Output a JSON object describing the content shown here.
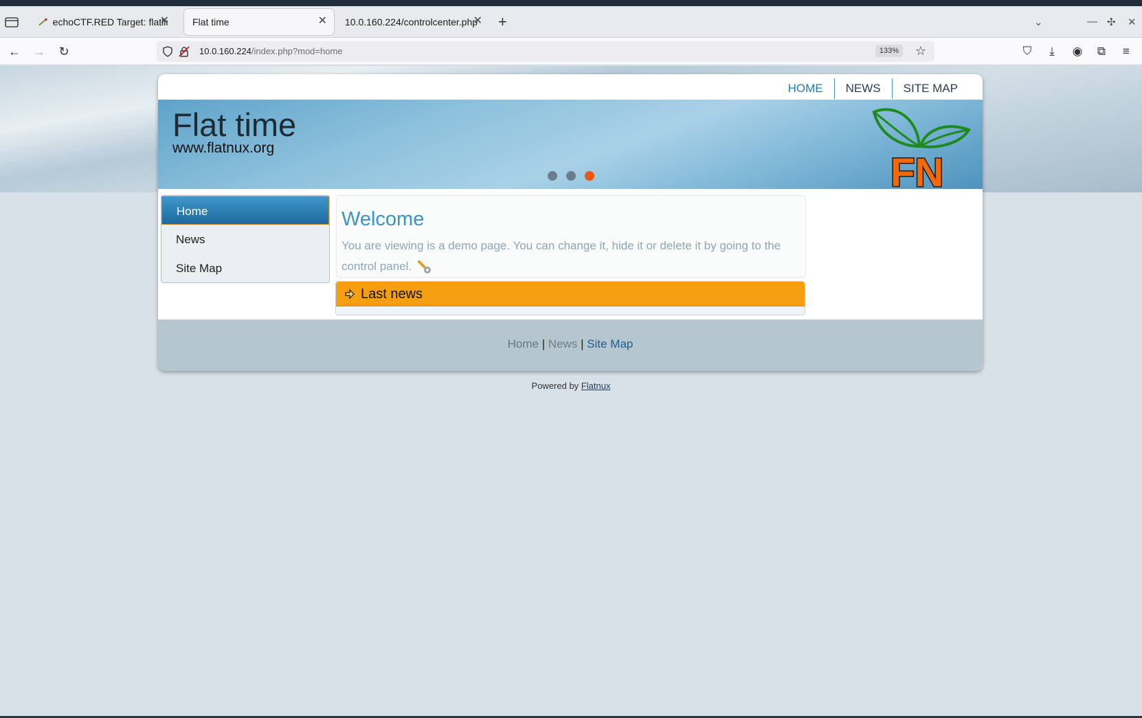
{
  "browser": {
    "tabs": [
      {
        "title": "echoCTF.RED Target: flatliner",
        "active": false
      },
      {
        "title": "Flat time",
        "active": true
      },
      {
        "title": "10.0.160.224/controlcenter.php",
        "active": false
      }
    ],
    "url_host": "10.0.160.224",
    "url_path": "/index.php?mod=home",
    "zoom": "133%"
  },
  "site": {
    "top_nav": [
      "HOME",
      "NEWS",
      "SITE MAP"
    ],
    "title": "Flat time",
    "subtitle": "www.flatnux.org",
    "logo_text": "FN",
    "slider_active_index": 2,
    "sidebar": [
      "Home",
      "News",
      "Site Map"
    ],
    "welcome": {
      "heading": "Welcome",
      "text": "You are viewing is a demo page. You can change it, hide it or delete it by going to the control panel."
    },
    "news_title": "Last news",
    "footer_links": [
      "Home",
      "News",
      "Site Map"
    ],
    "powered_prefix": "Powered by",
    "powered_link": "Flatnux"
  },
  "colors": {
    "accent_blue": "#2a79ad",
    "news_orange": "#f59f10",
    "slider_active": "#e85a14"
  }
}
